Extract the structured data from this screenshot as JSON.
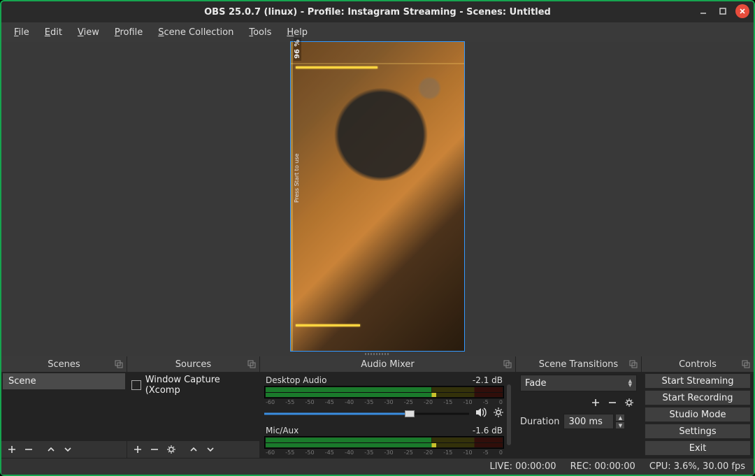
{
  "window": {
    "title": "OBS 25.0.7 (linux) - Profile: Instagram Streaming - Scenes: Untitled"
  },
  "menu": {
    "file": "File",
    "edit": "Edit",
    "view": "View",
    "profile": "Profile",
    "scene_collection": "Scene Collection",
    "tools": "Tools",
    "help": "Help"
  },
  "preview": {
    "percent_label": "96 %",
    "watermark": "Press Start to use"
  },
  "docks": {
    "scenes_title": "Scenes",
    "sources_title": "Sources",
    "mixer_title": "Audio Mixer",
    "transitions_title": "Scene Transitions",
    "controls_title": "Controls"
  },
  "scenes": {
    "items": [
      {
        "label": "Scene"
      }
    ]
  },
  "sources": {
    "items": [
      {
        "label": "Window Capture (Xcomp"
      }
    ]
  },
  "mixer": {
    "ticks": [
      "-60",
      "-55",
      "-50",
      "-45",
      "-40",
      "-35",
      "-30",
      "-25",
      "-20",
      "-15",
      "-10",
      "-5",
      "0"
    ],
    "channels": [
      {
        "name": "Desktop Audio",
        "db": "-2.1 dB",
        "fill_pct": 71,
        "muted": false
      },
      {
        "name": "Mic/Aux",
        "db": "-1.6 dB",
        "fill_pct": 72,
        "muted": true
      }
    ]
  },
  "transitions": {
    "selected": "Fade",
    "duration_label": "Duration",
    "duration_value": "300 ms"
  },
  "controls": {
    "start_streaming": "Start Streaming",
    "start_recording": "Start Recording",
    "studio_mode": "Studio Mode",
    "settings": "Settings",
    "exit": "Exit"
  },
  "status": {
    "live": "LIVE: 00:00:00",
    "rec": "REC: 00:00:00",
    "cpu": "CPU: 3.6%, 30.00 fps"
  }
}
